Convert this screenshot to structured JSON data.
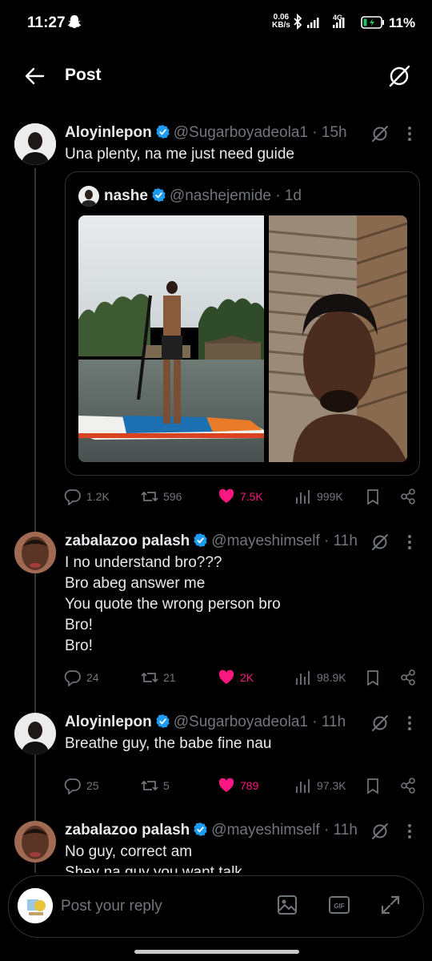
{
  "status_bar": {
    "time": "11:27",
    "net_speed_value": "0.06",
    "net_speed_unit": "KB/s",
    "network": "4G",
    "battery": "11%"
  },
  "header": {
    "title": "Post"
  },
  "posts": [
    {
      "name": "Aloyinlepon",
      "handle": "@Sugarboyadeola1",
      "time": "· 15h",
      "text": "Una plenty, na me just need guide",
      "quote": {
        "name": "nashe",
        "handle": "@nashejemide",
        "time": "· 1d"
      },
      "stats": {
        "replies": "1.2K",
        "reposts": "596",
        "likes": "7.5K",
        "views": "999K"
      }
    },
    {
      "name": "zabalazoo palash",
      "handle": "@mayeshimself",
      "time": "· 11h",
      "text": "I no understand bro???\nBro abeg answer me\nYou quote the wrong person bro\nBro!\nBro!",
      "stats": {
        "replies": "24",
        "reposts": "21",
        "likes": "2K",
        "views": "98.9K"
      }
    },
    {
      "name": "Aloyinlepon",
      "handle": "@Sugarboyadeola1",
      "time": "· 11h",
      "text": "Breathe guy, the babe fine nau",
      "stats": {
        "replies": "25",
        "reposts": "5",
        "likes": "789",
        "views": "97.3K"
      }
    },
    {
      "name": "zabalazoo palash",
      "handle": "@mayeshimself",
      "time": "· 11h",
      "text": "No guy, correct am\nShey na guy you want talk"
    }
  ],
  "reply_bar": {
    "placeholder": "Post your reply",
    "gif_label": "GIF"
  },
  "colors": {
    "background": "#000000",
    "text": "#e7e9ea",
    "muted": "#71767b",
    "like": "#f91880",
    "verified": "#1d9bf0",
    "border": "#2f3336"
  }
}
